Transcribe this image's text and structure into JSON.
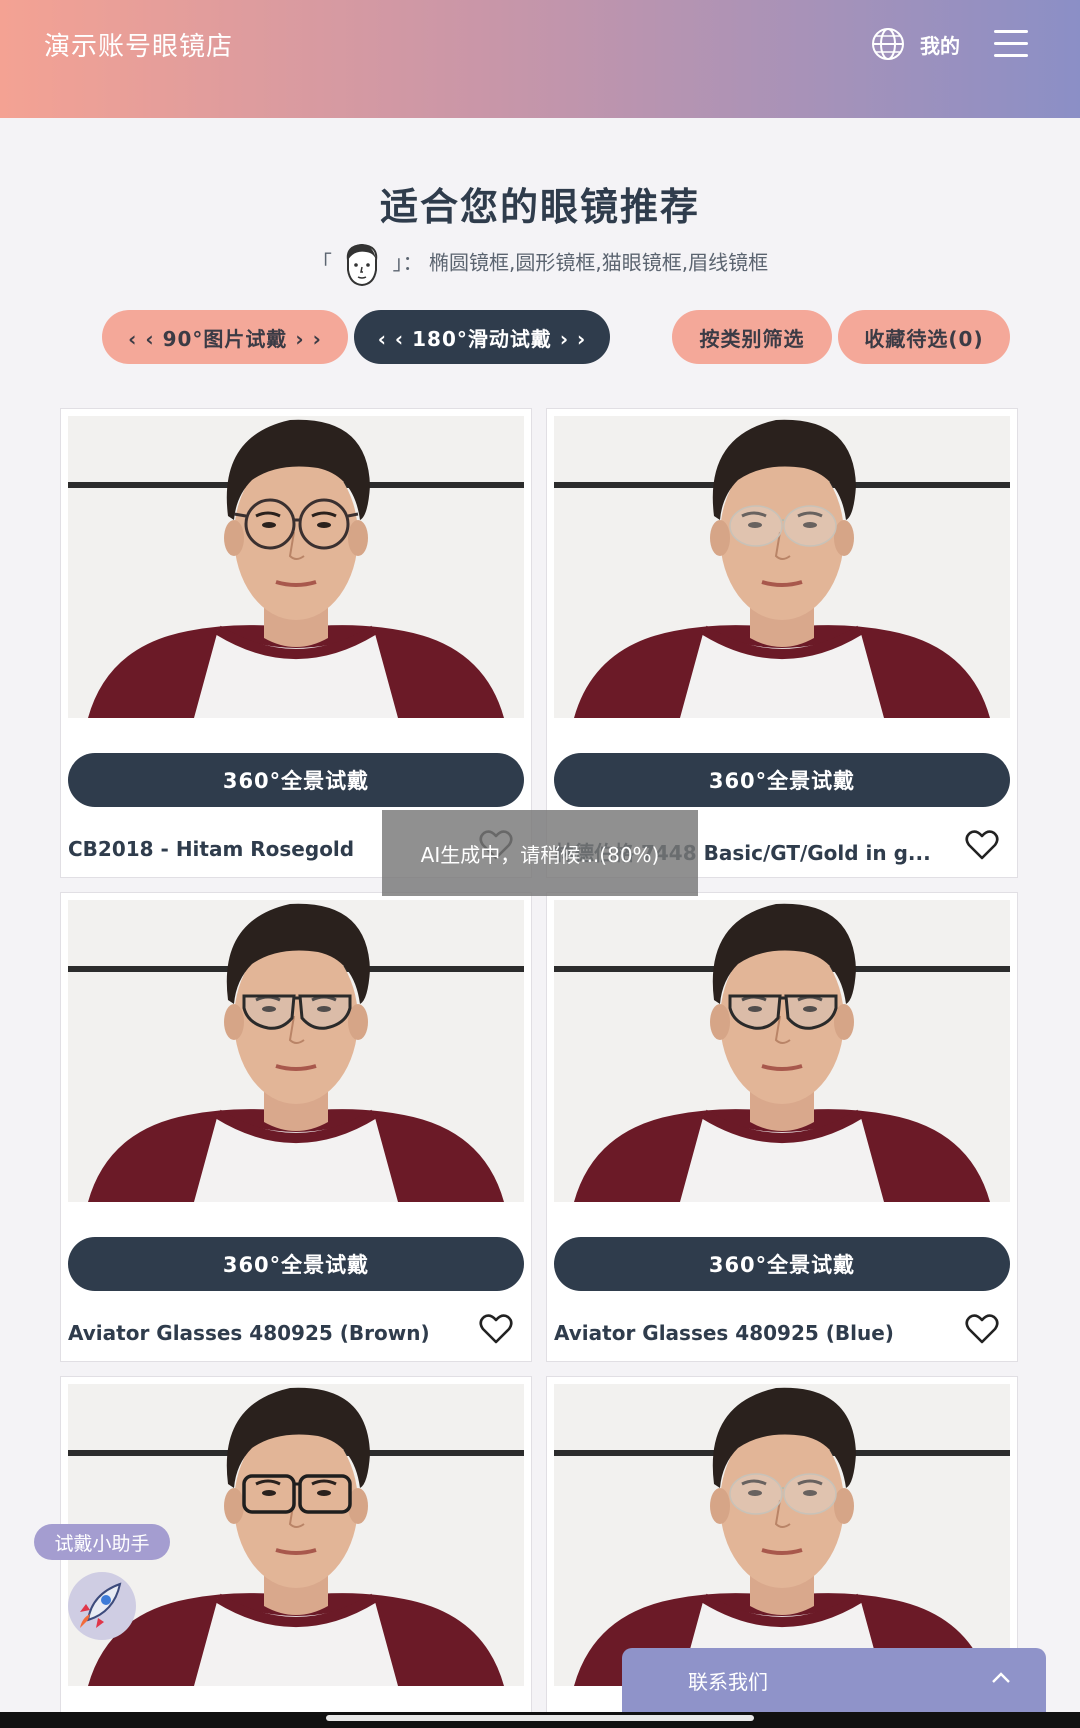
{
  "header": {
    "store_title": "演示账号眼镜店",
    "my_label": "我的"
  },
  "recommend": {
    "title": "适合您的眼镜推荐",
    "bracket_open": "「",
    "bracket_close": "」：",
    "frame_types": "椭圆镜框,圆形镜框,猫眼镜框,眉线镜框"
  },
  "buttons": {
    "try_90": "‹ ‹ 90°图片试戴 › ›",
    "try_180": "‹ ‹ 180°滑动试戴 › ›",
    "filter_category": "按类别筛选",
    "favorites": "收藏待选(0)"
  },
  "products": [
    {
      "try_label": "360°全景试戴",
      "name": "CB2018 - Hitam Rosegold",
      "frame": "round-thin"
    },
    {
      "try_label": "360°全景试戴",
      "name": "林德伯格 7448 Basic/GT/Gold in g...",
      "frame": "rimless"
    },
    {
      "try_label": "360°全景试戴",
      "name": "Aviator Glasses 480925 (Brown)",
      "frame": "aviator"
    },
    {
      "try_label": "360°全景试戴",
      "name": "Aviator Glasses 480925 (Blue)",
      "frame": "aviator"
    },
    {
      "try_label": "360°全景试戴",
      "name": "",
      "frame": "square"
    },
    {
      "try_label": "360°全景试戴",
      "name": "",
      "frame": "rimless"
    }
  ],
  "toast": {
    "text": "AI生成中，请稍候...(80%)"
  },
  "helper": {
    "label": "试戴小助手"
  },
  "contact": {
    "label": "联系我们"
  },
  "colors": {
    "header_start": "#f4a293",
    "header_end": "#8b8fc6",
    "accent_salmon": "#f4a899",
    "primary_dark": "#2f3c4c",
    "contact_bar": "#8f93c9"
  },
  "icons": [
    "globe-icon",
    "menu-icon",
    "face-icon",
    "heart-icon",
    "rocket-icon",
    "chevron-up-icon"
  ]
}
